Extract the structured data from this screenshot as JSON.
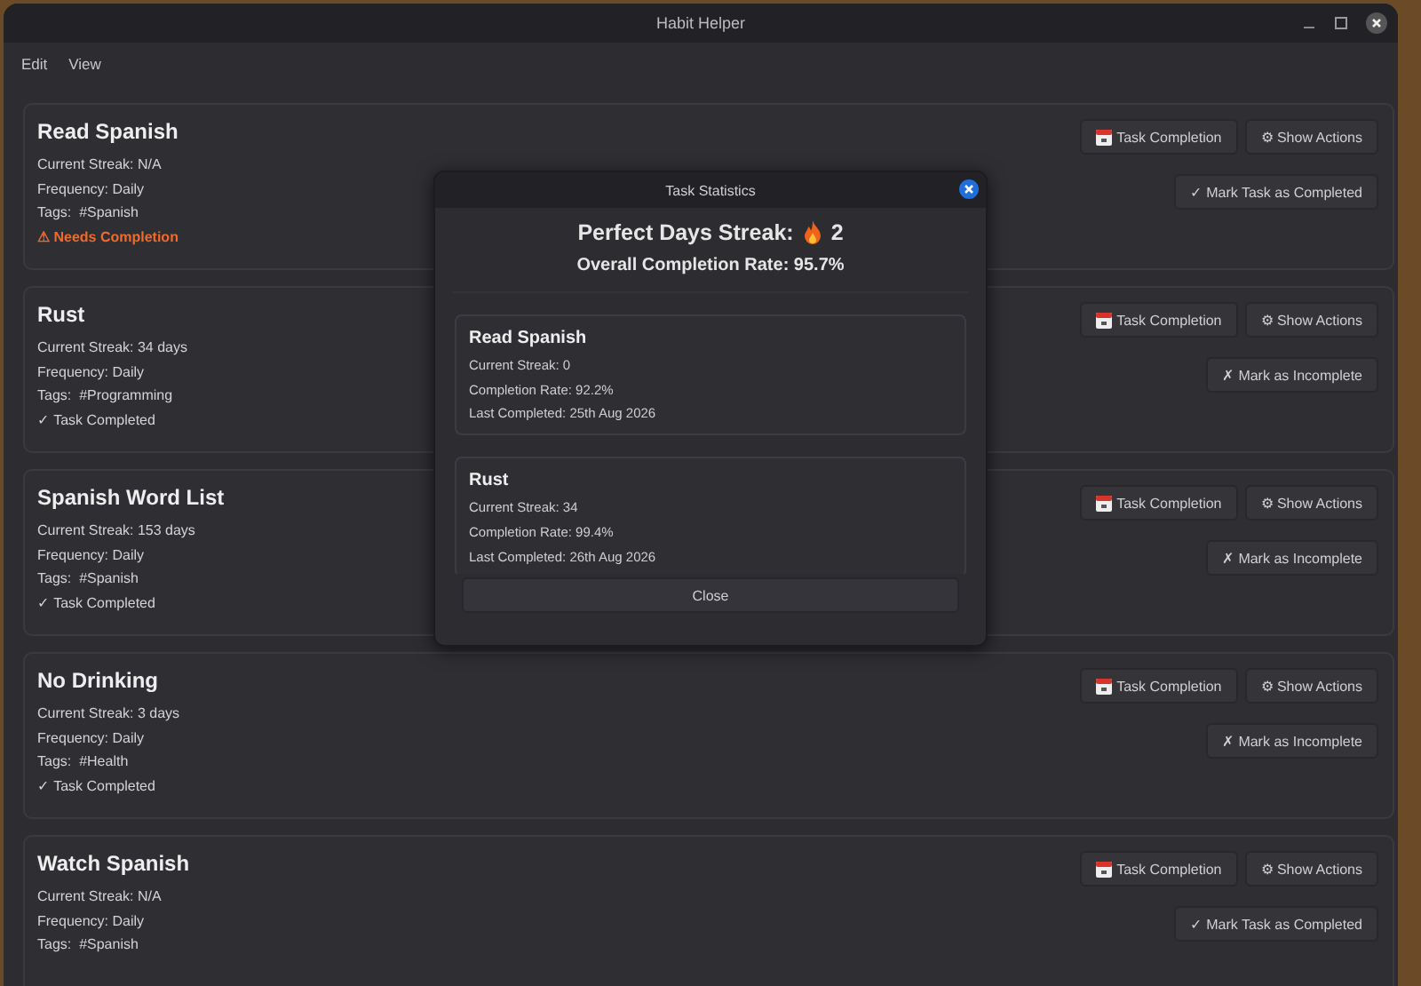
{
  "window": {
    "title": "Habit Helper"
  },
  "menu": [
    "Edit",
    "View"
  ],
  "habits": [
    {
      "name": "Read Spanish",
      "streak": "Current Streak: N/A",
      "frequency": "Frequency: Daily",
      "tags": "Tags:  #Spanish",
      "status": {
        "kind": "pending",
        "text": "⚠ Needs Completion"
      },
      "calendar_button": "Task Completion",
      "actions_button": "⚙ Show Actions",
      "toggle_button": "✓ Mark Task as Completed"
    },
    {
      "name": "Rust",
      "streak": "Current Streak: 34 days",
      "frequency": "Frequency: Daily",
      "tags": "Tags:  #Programming",
      "status": {
        "kind": "done",
        "text": "✓ Task Completed"
      },
      "calendar_button": "Task Completion",
      "actions_button": "⚙ Show Actions",
      "toggle_button": "✗ Mark as Incomplete"
    },
    {
      "name": "Spanish Word List",
      "streak": "Current Streak: 153 days",
      "frequency": "Frequency: Daily",
      "tags": "Tags:  #Spanish",
      "status": {
        "kind": "done",
        "text": "✓ Task Completed"
      },
      "calendar_button": "Task Completion",
      "actions_button": "⚙ Show Actions",
      "toggle_button": "✗ Mark as Incomplete"
    },
    {
      "name": "No Drinking",
      "streak": "Current Streak: 3 days",
      "frequency": "Frequency: Daily",
      "tags": "Tags:  #Health",
      "status": {
        "kind": "done",
        "text": "✓ Task Completed"
      },
      "calendar_button": "Task Completion",
      "actions_button": "⚙ Show Actions",
      "toggle_button": "✗ Mark as Incomplete"
    },
    {
      "name": "Watch Spanish",
      "streak": "Current Streak: N/A",
      "frequency": "Frequency: Daily",
      "tags": "Tags:  #Spanish",
      "calendar_button": "Task Completion",
      "actions_button": "⚙ Show Actions",
      "toggle_button": "✓ Mark Task as Completed"
    }
  ],
  "dialog": {
    "title": "Task Statistics",
    "perfect_streak": {
      "label": "Perfect Days Streak:",
      "value": "2"
    },
    "overall": "Overall Completion Rate: 95.7%",
    "stats": [
      {
        "name": "Read Spanish",
        "lines": [
          "Current Streak: 0",
          "Completion Rate: 92.2%",
          "Last Completed: 25th Aug 2026"
        ]
      },
      {
        "name": "Rust",
        "lines": [
          "Current Streak: 34",
          "Completion Rate: 99.4%",
          "Last Completed: 26th Aug 2026"
        ]
      }
    ],
    "close_button": "Close"
  }
}
